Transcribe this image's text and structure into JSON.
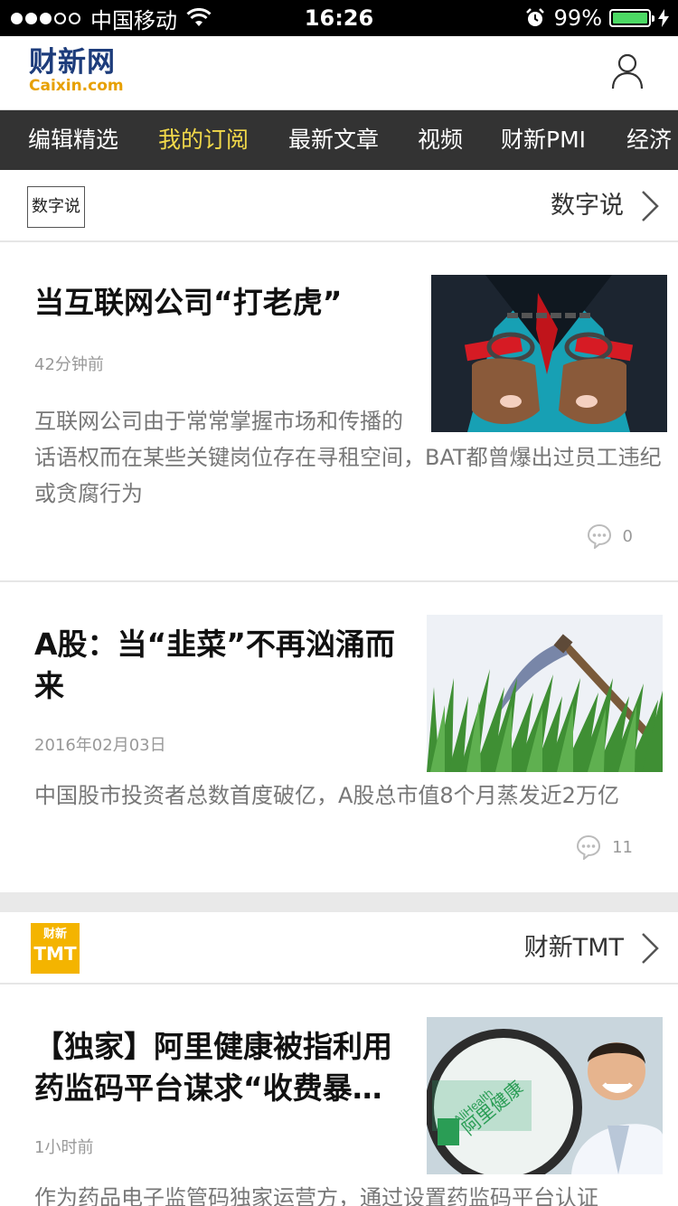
{
  "status_bar": {
    "carrier": "中国移动",
    "time": "16:26",
    "battery": "99%",
    "battery_level": 0.99
  },
  "header": {
    "logo_cn": "财新网",
    "logo_en": "Caixin.com",
    "user_icon": "user-icon"
  },
  "nav": {
    "items": [
      {
        "label": "编辑精选"
      },
      {
        "label": "我的订阅"
      },
      {
        "label": "最新文章"
      },
      {
        "label": "视频"
      },
      {
        "label": "财新PMI"
      },
      {
        "label": "经济"
      }
    ],
    "active_index": 1,
    "active_color": "#f2d94a"
  },
  "sections": [
    {
      "title": "数字说",
      "logo_text": "数字说",
      "articles": [
        {
          "title": "当互联网公司“打老虎”",
          "time": "42分钟前",
          "summary": "互联网公司由于常常掌握市场和传播的话语权而在某些关键岗位存在寻租空间，BAT都曾爆出过员工违纪或贪腐行为",
          "comments": "0"
        },
        {
          "title": "A股：当“韭菜”不再汹涌而来",
          "time": "2016年02月03日",
          "summary": "中国股市投资者总数首度破亿，A股总市值8个月蒸发近2万亿",
          "comments": "11"
        }
      ]
    },
    {
      "title": "财新TMT",
      "logo_line1": "财新",
      "logo_line2": "TMT",
      "logo_color": "#f4b400",
      "articles": [
        {
          "title": "【独家】阿里健康被指利用药监码平台谋求“收费暴…",
          "time": "1小时前",
          "summary": "作为药品电子监管码独家运营方，通过设置药监码平台认证",
          "image_text_en": "AliHealth",
          "image_text_cn": "阿里健康"
        }
      ]
    }
  ]
}
